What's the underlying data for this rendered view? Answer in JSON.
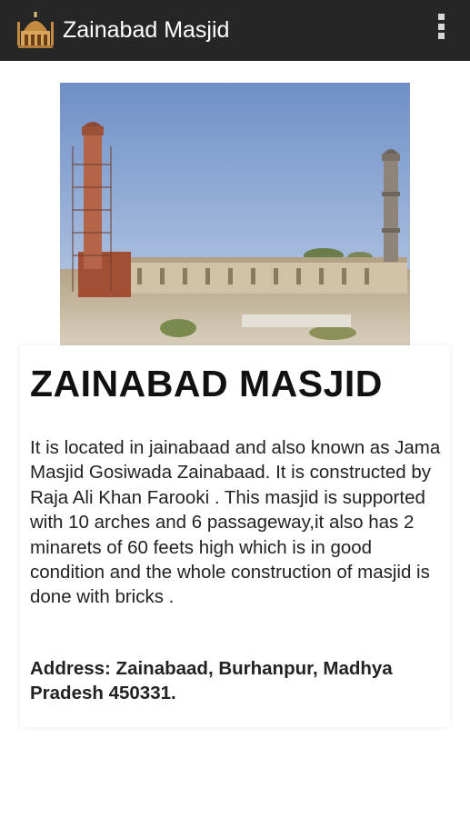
{
  "app_bar": {
    "title": "Zainabad Masjid",
    "icon": "mosque-logo-icon",
    "overflow_icon": "more-vert-icon",
    "background": "#262626"
  },
  "content": {
    "photo_icon": "mosque-photo",
    "heading": "ZAINABAD MASJID",
    "description": "It is located in jainabaad and also known as Jama Masjid Gosiwada Zainabaad. It is constructed by Raja Ali Khan Farooki . This masjid is supported with 10 arches and 6 passageway,it also has 2 minarets of 60 feets high which is in good condition and the whole construction of masjid is done with bricks .",
    "address": "Address: Zainabaad, Burhanpur, Madhya Pradesh 450331."
  }
}
